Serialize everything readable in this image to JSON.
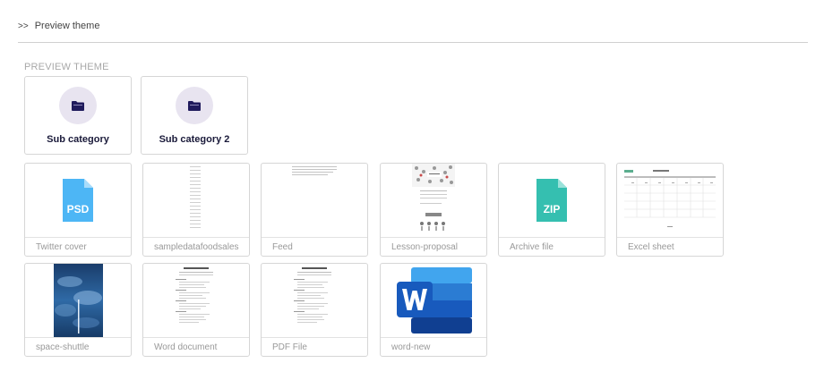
{
  "breadcrumb": {
    "separator": ">>",
    "label": "Preview theme"
  },
  "section": {
    "title": "PREVIEW THEME"
  },
  "categories": [
    {
      "label": "Sub category",
      "icon": "folder-icon"
    },
    {
      "label": "Sub category 2",
      "icon": "folder-icon"
    }
  ],
  "files": [
    {
      "name": "Twitter cover",
      "type": "PSD",
      "thumb": "psd-icon",
      "color": "#4db6f5"
    },
    {
      "name": "sampledatafoodsales",
      "thumb": "spreadsheet-preview"
    },
    {
      "name": "Feed",
      "thumb": "text-preview"
    },
    {
      "name": "Lesson-proposal",
      "thumb": "lesson-preview"
    },
    {
      "name": "Archive file",
      "type": "ZIP",
      "thumb": "zip-icon",
      "color": "#35bfb0"
    },
    {
      "name": "Excel sheet",
      "thumb": "calendar-preview"
    },
    {
      "name": "space-shuttle",
      "thumb": "photo-preview"
    },
    {
      "name": "Word document",
      "thumb": "resume-preview"
    },
    {
      "name": "PDF File",
      "thumb": "resume-preview"
    },
    {
      "name": "word-new",
      "thumb": "word-icon",
      "color": "#2b579a"
    }
  ],
  "colors": {
    "folder": "#1f1a5c",
    "circle": "#e8e4f0",
    "border": "#d6d6d6"
  }
}
